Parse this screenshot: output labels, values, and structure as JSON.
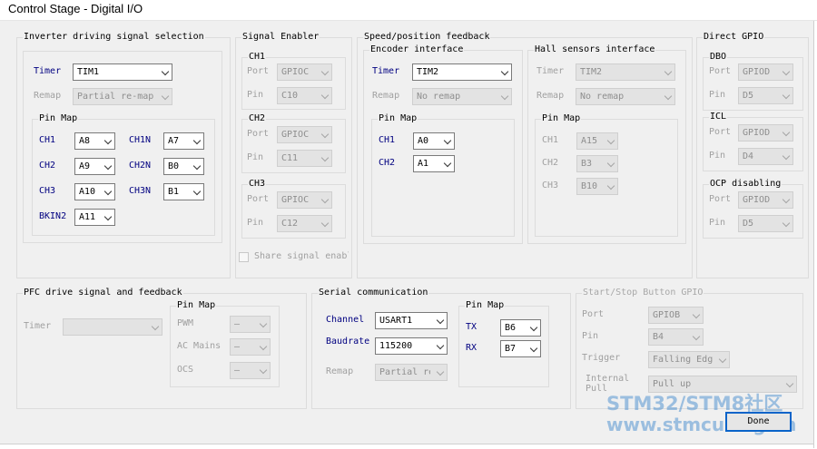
{
  "window": {
    "title": "Control Stage - Digital I/O"
  },
  "inverter": {
    "title": "Inverter driving signal selection",
    "timer_label": "Timer",
    "timer_value": "TIM1",
    "remap_label": "Remap",
    "remap_value": "Partial re-map",
    "pinmap_title": "Pin Map",
    "ch1_label": "CH1",
    "ch1_value": "A8",
    "ch1n_label": "CH1N",
    "ch1n_value": "A7",
    "ch2_label": "CH2",
    "ch2_value": "A9",
    "ch2n_label": "CH2N",
    "ch2n_value": "B0",
    "ch3_label": "CH3",
    "ch3_value": "A10",
    "ch3n_label": "CH3N",
    "ch3n_value": "B1",
    "bkin2_label": "BKIN2",
    "bkin2_value": "A11"
  },
  "signal_enabler": {
    "title": "Signal Enabler",
    "port_label": "Port",
    "pin_label": "Pin",
    "ch1_title": "CH1",
    "ch1_port": "GPIOC",
    "ch1_pin": "C10",
    "ch2_title": "CH2",
    "ch2_port": "GPIOC",
    "ch2_pin": "C11",
    "ch3_title": "CH3",
    "ch3_port": "GPIOC",
    "ch3_pin": "C12",
    "share_label": "Share signal enabl"
  },
  "speed": {
    "title": "Speed/position feedback",
    "encoder_title": "Encoder interface",
    "enc_timer_label": "Timer",
    "enc_timer_value": "TIM2",
    "enc_remap_label": "Remap",
    "enc_remap_value": "No remap",
    "enc_pinmap_title": "Pin Map",
    "enc_ch1_label": "CH1",
    "enc_ch1_value": "A0",
    "enc_ch2_label": "CH2",
    "enc_ch2_value": "A1",
    "hall_title": "Hall sensors interface",
    "hall_timer_label": "Timer",
    "hall_timer_value": "TIM2",
    "hall_remap_label": "Remap",
    "hall_remap_value": "No remap",
    "hall_pinmap_title": "Pin Map",
    "hall_ch1_label": "CH1",
    "hall_ch1_value": "A15",
    "hall_ch2_label": "CH2",
    "hall_ch2_value": "B3",
    "hall_ch3_label": "CH3",
    "hall_ch3_value": "B10"
  },
  "direct_gpio": {
    "title": "Direct GPIO",
    "port_label": "Port",
    "pin_label": "Pin",
    "dbo_title": "DBO",
    "dbo_port": "GPIOD",
    "dbo_pin": "D5",
    "icl_title": "ICL",
    "icl_port": "GPIOD",
    "icl_pin": "D4",
    "ocp_title": "OCP disabling",
    "ocp_port": "GPIOD",
    "ocp_pin": "D5"
  },
  "pfc": {
    "title": "PFC drive signal and feedback",
    "timer_label": "Timer",
    "timer_value": "",
    "pinmap_title": "Pin Map",
    "pwm_label": "PWM",
    "acmains_label": "AC Mains",
    "ocs_label": "OCS",
    "empty_value": "—"
  },
  "serial": {
    "title": "Serial communication",
    "channel_label": "Channel",
    "channel_value": "USART1",
    "baud_label": "Baudrate",
    "baud_value": "115200",
    "remap_label": "Remap",
    "remap_value": "Partial re",
    "pinmap_title": "Pin Map",
    "tx_label": "TX",
    "tx_value": "B6",
    "rx_label": "RX",
    "rx_value": "B7"
  },
  "startstop": {
    "title": "Start/Stop Button GPIO",
    "port_label": "Port",
    "port_value": "GPIOB",
    "pin_label": "Pin",
    "pin_value": "B4",
    "trigger_label": "Trigger",
    "trigger_value": "Falling Edg",
    "pull_label1": "Internal",
    "pull_label2": "Pull",
    "pull_value": "Pull up"
  },
  "footer": {
    "done_label": "Done"
  },
  "watermark": {
    "line1": "STM32/STM8社区",
    "line2": "www.stmcu.org.cn"
  }
}
